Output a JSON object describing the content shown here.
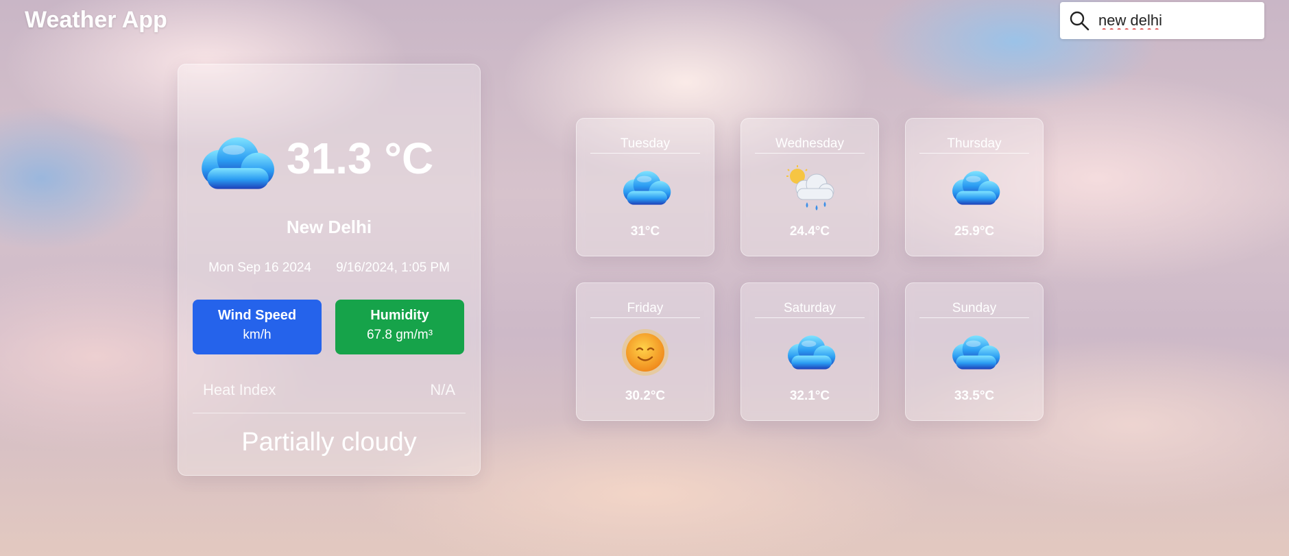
{
  "header": {
    "title": "Weather App"
  },
  "search": {
    "value": "new delhi",
    "icon": "search-icon"
  },
  "current": {
    "icon": "cloud-icon",
    "temperature": "31.3 °C",
    "city": "New Delhi",
    "date": "Mon Sep 16 2024",
    "datetime": "9/16/2024, 1:05 PM",
    "wind": {
      "label": "Wind Speed",
      "value": "km/h",
      "color": "#2563eb"
    },
    "humidity": {
      "label": "Humidity",
      "value": "67.8 gm/m³",
      "color": "#16a34a"
    },
    "heat_index": {
      "label": "Heat Index",
      "value": "N/A"
    },
    "condition": "Partially cloudy"
  },
  "forecast": [
    {
      "day": "Tuesday",
      "temp": "31°C",
      "icon": "cloud-icon"
    },
    {
      "day": "Wednesday",
      "temp": "24.4°C",
      "icon": "sun-cloud-rain-icon"
    },
    {
      "day": "Thursday",
      "temp": "25.9°C",
      "icon": "cloud-icon"
    },
    {
      "day": "Friday",
      "temp": "30.2°C",
      "icon": "sun-icon"
    },
    {
      "day": "Saturday",
      "temp": "32.1°C",
      "icon": "cloud-icon"
    },
    {
      "day": "Sunday",
      "temp": "33.5°C",
      "icon": "cloud-icon"
    }
  ]
}
